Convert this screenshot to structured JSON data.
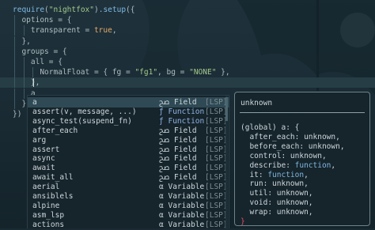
{
  "editor": {
    "lines": [
      {
        "t": [
          [
            "require",
            "fn"
          ],
          [
            "(",
            "pn"
          ],
          [
            "\"nightfox\"",
            "str"
          ],
          [
            ")",
            "pn"
          ],
          [
            ".setup",
            "fn"
          ],
          [
            "({",
            "pn"
          ]
        ]
      },
      {
        "t": [
          [
            "  options = {",
            "pn"
          ]
        ]
      },
      {
        "t": [
          [
            "    transparent = ",
            "pn"
          ],
          [
            "true",
            "cst"
          ],
          [
            ",",
            "pn"
          ]
        ]
      },
      {
        "t": [
          [
            "  },",
            "pn"
          ]
        ]
      },
      {
        "t": [
          [
            "  groups = {",
            "pn"
          ]
        ]
      },
      {
        "t": [
          [
            "    all = {",
            "pn"
          ]
        ]
      },
      {
        "t": [
          [
            "      NormalFloat = { fg = ",
            "pn"
          ],
          [
            "\"fg1\"",
            "str"
          ],
          [
            ", bg = ",
            "pn"
          ],
          [
            "\"NONE\"",
            "str"
          ],
          [
            " },",
            "pn"
          ]
        ]
      },
      {
        "t": [
          [
            "    },",
            "pn"
          ]
        ]
      },
      {
        "t": [
          [
            "    a",
            "pn"
          ]
        ]
      },
      {
        "t": [
          [
            "  }",
            "pn"
          ]
        ]
      },
      {
        "t": [
          [
            "})",
            "pn"
          ]
        ]
      }
    ]
  },
  "completion": {
    "items": [
      {
        "label": "a",
        "kind": "Field",
        "glyph": "ﰠ",
        "source": "[LSP]",
        "selected": true
      },
      {
        "label": "assert(v, message, ...)",
        "kind": "Function",
        "glyph": "ƒ",
        "source": "[LSP]"
      },
      {
        "label": "async_test(suspend_fn)",
        "kind": "Function",
        "glyph": "ƒ",
        "source": "[LSP]"
      },
      {
        "label": "after_each",
        "kind": "Field",
        "glyph": "ﰠ",
        "source": "[LSP]"
      },
      {
        "label": "arg",
        "kind": "Field",
        "glyph": "ﰠ",
        "source": "[LSP]"
      },
      {
        "label": "assert",
        "kind": "Field",
        "glyph": "ﰠ",
        "source": "[LSP]"
      },
      {
        "label": "async",
        "kind": "Field",
        "glyph": "ﰠ",
        "source": "[LSP]"
      },
      {
        "label": "await",
        "kind": "Field",
        "glyph": "ﰠ",
        "source": "[LSP]"
      },
      {
        "label": "await_all",
        "kind": "Field",
        "glyph": "ﰠ",
        "source": "[LSP]"
      },
      {
        "label": "aerial",
        "kind": "Variable",
        "glyph": "α",
        "source": "[LSP]"
      },
      {
        "label": "ansiblels",
        "kind": "Variable",
        "glyph": "α",
        "source": "[LSP]"
      },
      {
        "label": "alpine",
        "kind": "Variable",
        "glyph": "α",
        "source": "[LSP]"
      },
      {
        "label": "asm_lsp",
        "kind": "Variable",
        "glyph": "α",
        "source": "[LSP]"
      },
      {
        "label": "actions",
        "kind": "Variable",
        "glyph": "α",
        "source": "[LSP]"
      }
    ]
  },
  "doc": {
    "title": "unknown",
    "lines": [
      [
        [
          "(global) a: {",
          "pn"
        ]
      ],
      [
        [
          "  after_each: unknown,",
          "pn"
        ]
      ],
      [
        [
          "  before_each: unknown,",
          "pn"
        ]
      ],
      [
        [
          "  control: unknown,",
          "pn"
        ]
      ],
      [
        [
          "  describe: ",
          "pn"
        ],
        [
          "function",
          "dk"
        ],
        [
          ",",
          "pn"
        ]
      ],
      [
        [
          "  it: ",
          "pn"
        ],
        [
          "function",
          "dk"
        ],
        [
          ",",
          "pn"
        ]
      ],
      [
        [
          "  run: unknown,",
          "pn"
        ]
      ],
      [
        [
          "  util: unknown,",
          "pn"
        ]
      ],
      [
        [
          "  void: unknown,",
          "pn"
        ]
      ],
      [
        [
          "  wrap: unknown,",
          "pn"
        ]
      ],
      [
        [
          "}",
          "brace"
        ]
      ]
    ]
  },
  "colors": {
    "background": "#1b2b33",
    "string": "#a3c98b",
    "function": "#7fb8e0",
    "constant": "#e0a96b",
    "selection": "#2f4a55",
    "brace": "#e0506a"
  },
  "icons": {
    "field": "field-icon",
    "function": "function-icon",
    "variable": "variable-icon"
  }
}
